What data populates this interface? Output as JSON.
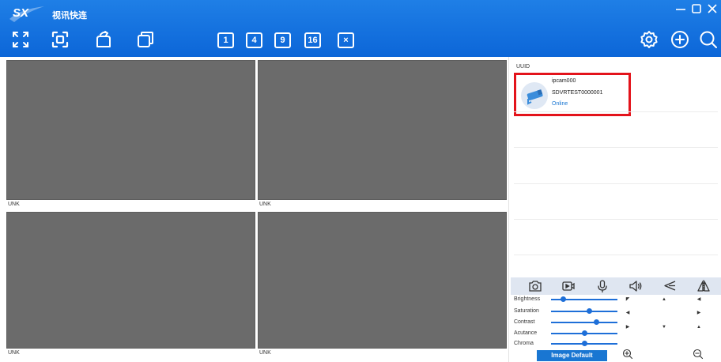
{
  "header": {
    "logo_text": "SX",
    "title": "视讯快连",
    "window_controls": [
      "minimize",
      "maximize",
      "close"
    ],
    "toolbar_left": [
      "fullscreen-icon",
      "capture-frame-icon",
      "rotate-icon",
      "copy-window-icon"
    ],
    "layouts": [
      "1",
      "4",
      "9",
      "16",
      "×"
    ],
    "toolbar_right": [
      "settings-icon",
      "add-icon",
      "search-icon"
    ]
  },
  "grid": {
    "panes": [
      {
        "label": "UNK"
      },
      {
        "label": "UNK"
      },
      {
        "label": "UNK"
      },
      {
        "label": "UNK"
      }
    ]
  },
  "devices": {
    "header": "UUID",
    "items": [
      {
        "name": "ipcam000",
        "serial": "SDVRTEST0000001",
        "status": "Online"
      }
    ]
  },
  "controls": {
    "icons": [
      "snapshot-icon",
      "record-icon",
      "microphone-icon",
      "speaker-icon",
      "flip-icon",
      "mirror-icon"
    ],
    "adjustments": [
      {
        "label": "Brightness",
        "value": 0.15
      },
      {
        "label": "Saturation",
        "value": 0.58
      },
      {
        "label": "Contrast",
        "value": 0.7
      },
      {
        "label": "Acutance",
        "value": 0.5
      },
      {
        "label": "Chroma",
        "value": 0.5
      }
    ],
    "image_default_label": "Image Default"
  },
  "colors": {
    "header_blue": "#0c66d8",
    "highlight_red": "#e3131b",
    "slider_blue": "#1e6fd8",
    "status_blue": "#1976d2",
    "video_gray": "#6b6b6b"
  }
}
